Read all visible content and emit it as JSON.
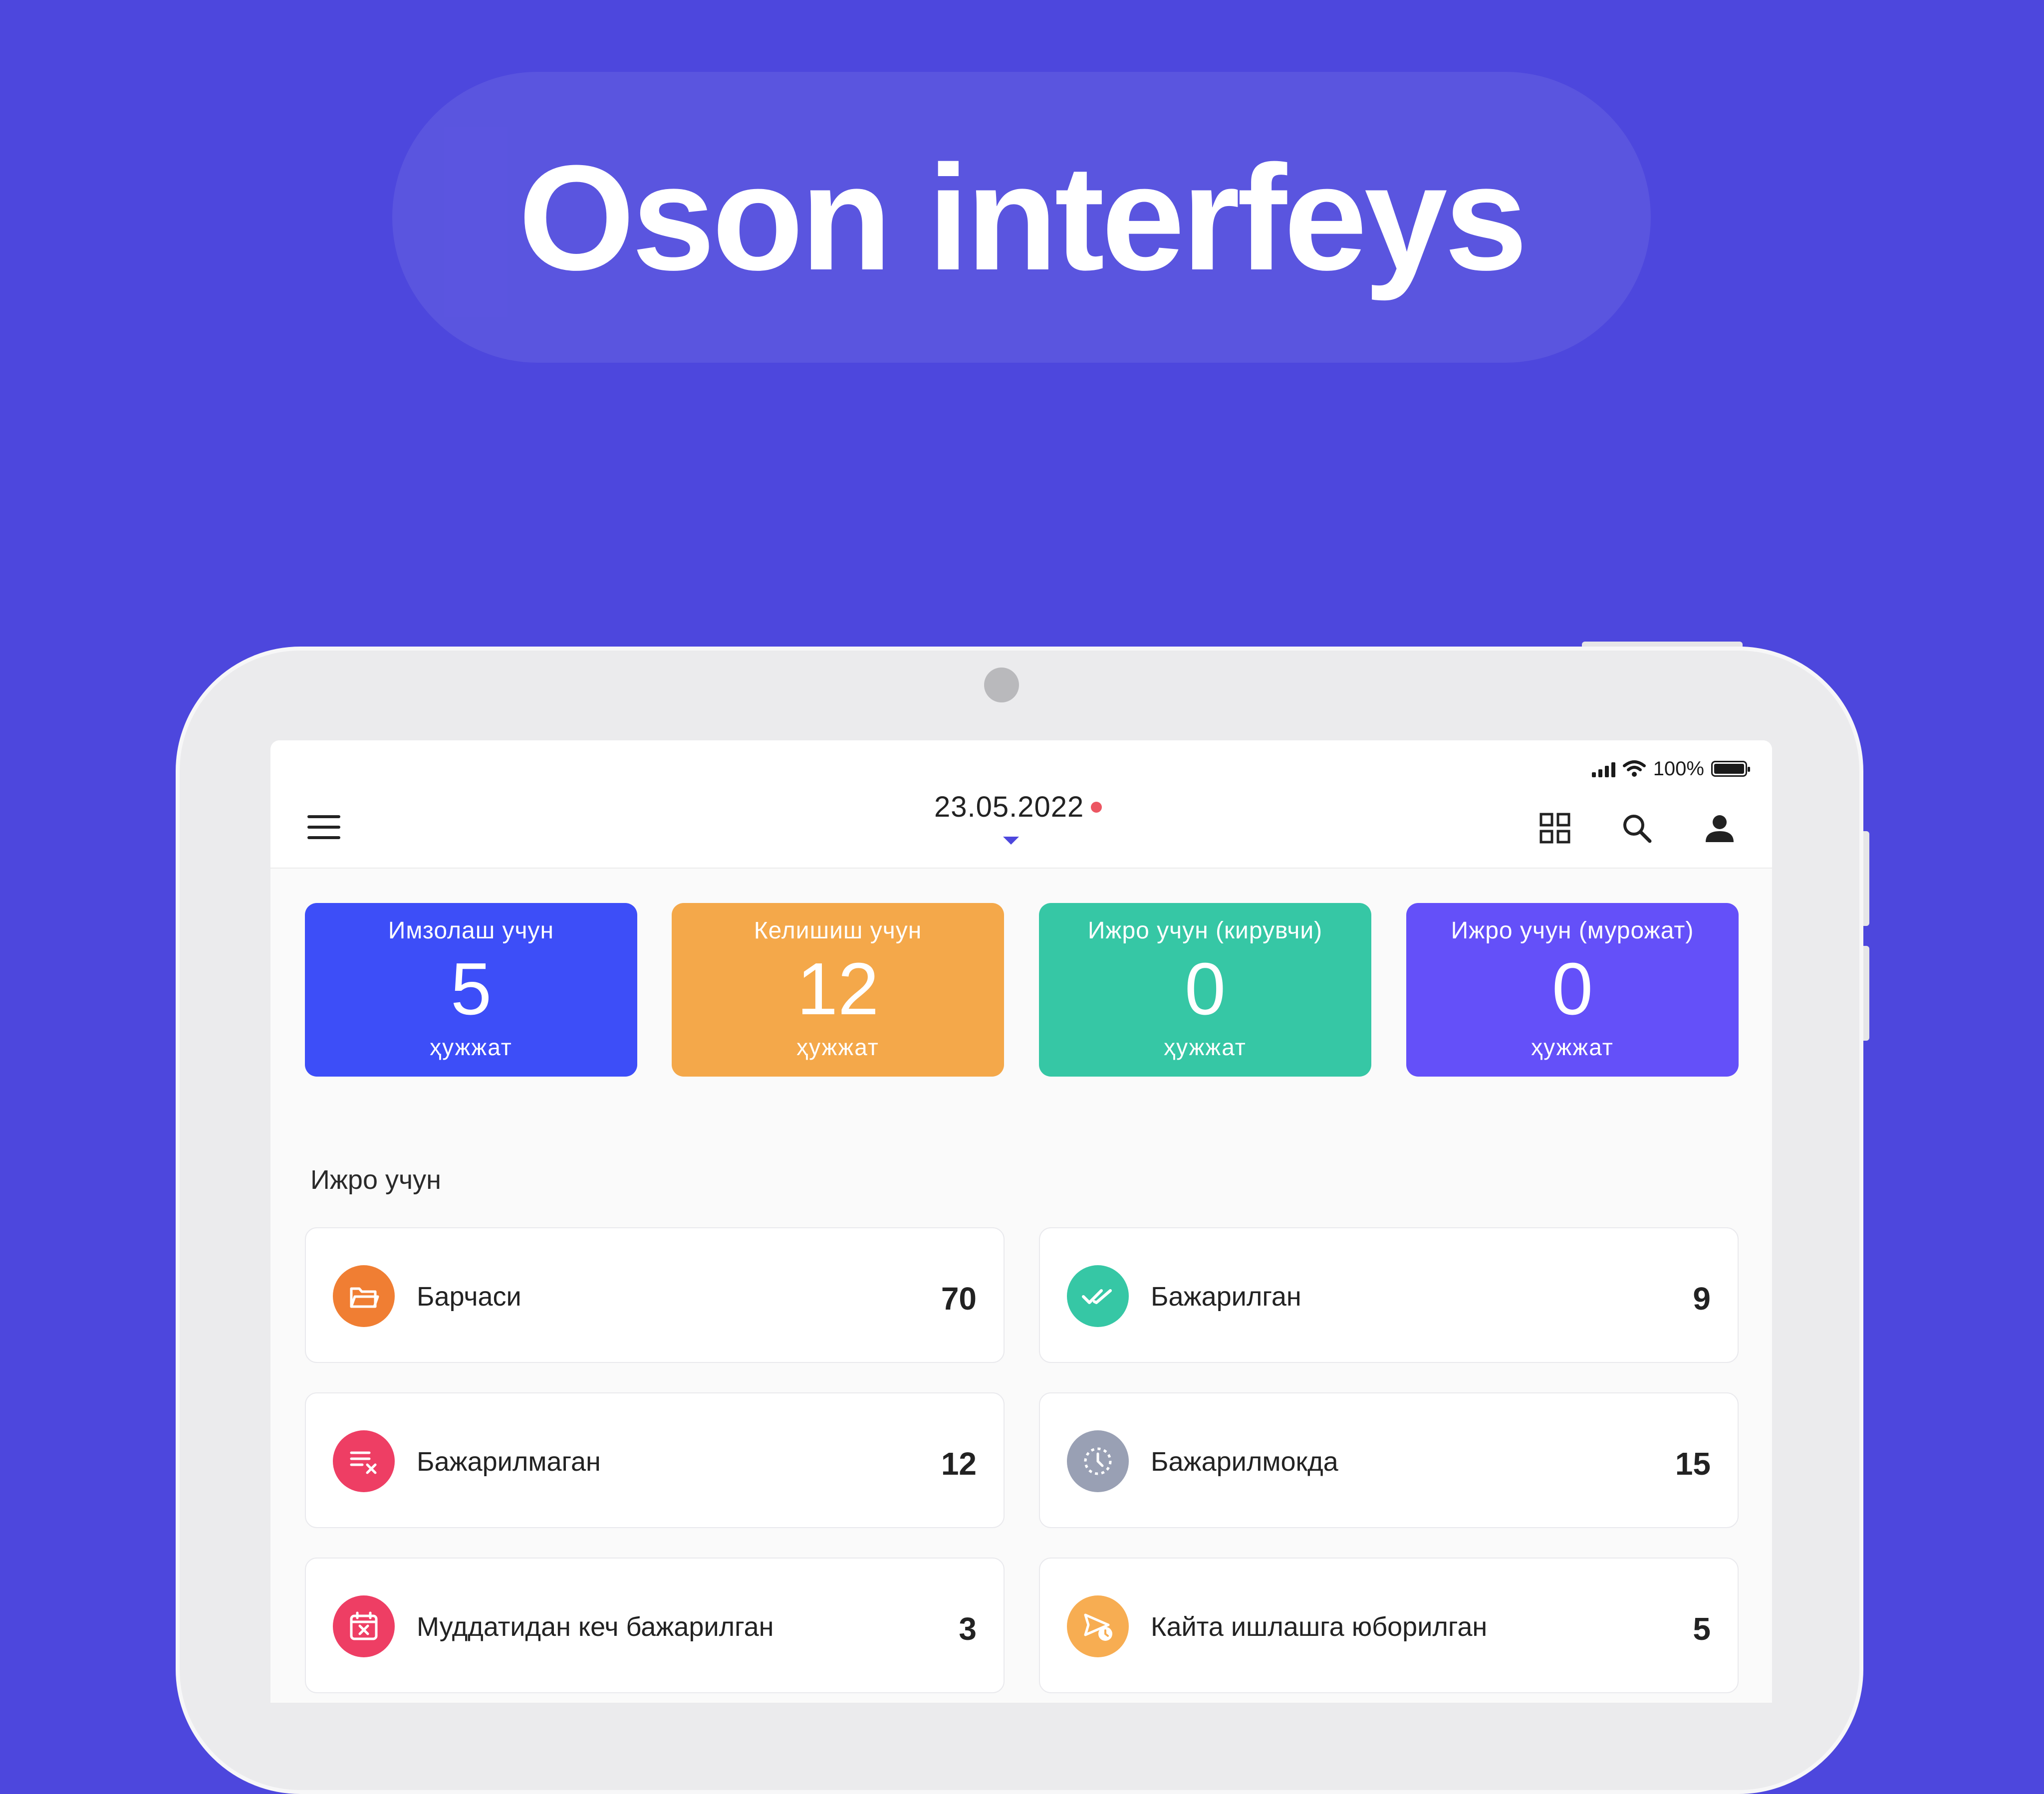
{
  "headline": "Oson interfeys",
  "status": {
    "battery": "100%"
  },
  "appbar": {
    "date": "23.05.2022"
  },
  "stats": [
    {
      "title": "Имзолаш учун",
      "value": "5",
      "unit": "ҳужжат",
      "color": "#3d4ef8"
    },
    {
      "title": "Келишиш учун",
      "value": "12",
      "unit": "ҳужжат",
      "color": "#f4a84a"
    },
    {
      "title": "Ижро учун (кирувчи)",
      "value": "0",
      "unit": "ҳужжат",
      "color": "#36c7a5"
    },
    {
      "title": "Ижро учун (мурожат)",
      "value": "0",
      "unit": "ҳужжат",
      "color": "#6450f9"
    }
  ],
  "section": {
    "title": "Ижро учун"
  },
  "items": [
    {
      "label": "Барчаси",
      "count": "70",
      "icon": "folder-icon",
      "color": "#f07e33"
    },
    {
      "label": "Бажарилган",
      "count": "9",
      "icon": "double-check-icon",
      "color": "#36c7a5"
    },
    {
      "label": "Бажарилмаган",
      "count": "12",
      "icon": "list-x-icon",
      "color": "#ee3e64"
    },
    {
      "label": "Бажарилмокда",
      "count": "15",
      "icon": "clock-progress-icon",
      "color": "#99a0b4"
    },
    {
      "label": "Муддатидан кеч бажарилган",
      "count": "3",
      "icon": "calendar-x-icon",
      "color": "#ee3e64"
    },
    {
      "label": "Кайта ишлашга юборилган",
      "count": "5",
      "icon": "send-clock-icon",
      "color": "#f7ad52"
    }
  ]
}
